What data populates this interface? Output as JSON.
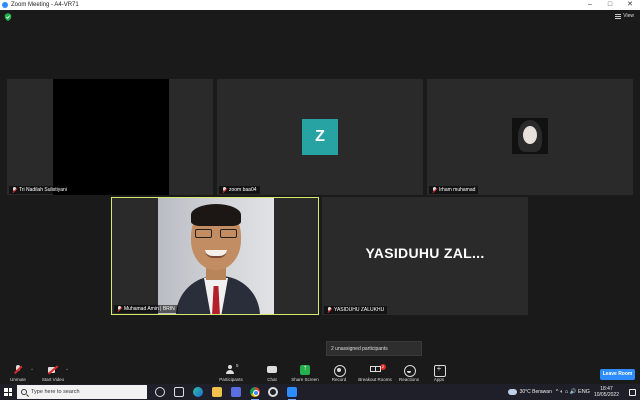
{
  "window": {
    "title": "Zoom Meeting - A4-VR71",
    "controls": [
      "–",
      "□",
      "✕"
    ]
  },
  "header": {
    "view_label": "View"
  },
  "tiles": [
    {
      "name": "Tri Nadilah Sulistiyani",
      "type": "video-black"
    },
    {
      "name": "zoom baa04",
      "type": "avatar",
      "avatar_letter": "Z",
      "avatar_color": "#27a3a3"
    },
    {
      "name": "Irham muhamad",
      "type": "photo"
    },
    {
      "name": "Muhamad Amin | BRIN",
      "type": "video",
      "active_speaker": true,
      "highlight_color": "#d6e86e"
    },
    {
      "name": "YASIDUHU ZALUKHU",
      "type": "name-only",
      "display_name": "YASIDUHU  ZAL..."
    }
  ],
  "popup": {
    "unassigned": "2 unassigned participants"
  },
  "toolbar": {
    "unmute": "Unmute",
    "start_video": "Start Video",
    "participants": "Participants",
    "participants_count": "5",
    "chat": "Chat",
    "share_screen": "Share Screen",
    "record": "Record",
    "breakout": "Breakout Rooms",
    "breakout_badge": "2",
    "reactions": "Reactions",
    "apps": "Apps",
    "leave": "Leave Room"
  },
  "taskbar": {
    "search_placeholder": "Type here to search",
    "weather": "30°C  Berawan",
    "time": "18:47",
    "date": "10/05/2022",
    "tray_symbols": "^ ◐ ⌂ 🔊 ENG"
  }
}
